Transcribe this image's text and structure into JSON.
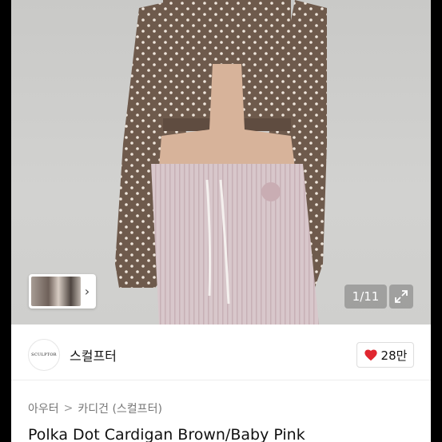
{
  "gallery": {
    "counter_text": "1/11",
    "thumb_chevron": "›"
  },
  "seller": {
    "logo_text": "SCULPTOR",
    "name": "스컬프터",
    "like_count": "28만"
  },
  "breadcrumb": {
    "level1": "아우터",
    "level2": "카디건 (스컬프터)",
    "separator": ">"
  },
  "product": {
    "title": "Polka Dot Cardigan Brown/Baby Pink"
  },
  "colors": {
    "heart": "#e0272f",
    "cardigan": "#6e5a4c",
    "pants": "#d6c4c8"
  }
}
